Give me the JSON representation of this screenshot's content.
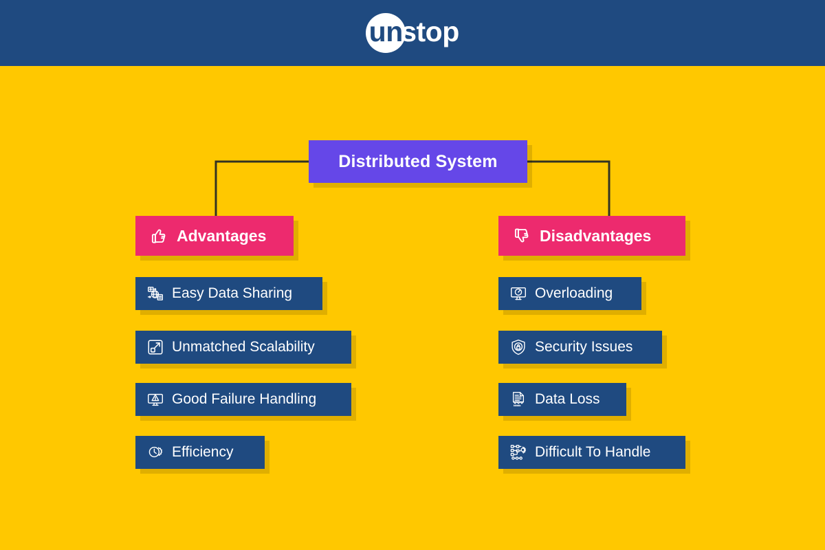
{
  "header": {
    "brand": {
      "mark_text": "un",
      "word_text": "stop",
      "full_name": "unstop"
    },
    "background_color": "#1F4A80"
  },
  "canvas": {
    "background_color": "#FFC800",
    "connector_color": "#333322"
  },
  "diagram": {
    "type": "tree",
    "root": {
      "label": "Distributed System",
      "color": "#6547E8"
    },
    "branches": [
      {
        "id": "advantages",
        "label": "Advantages",
        "icon": "thumbs-up-icon",
        "color": "#ED2A6E",
        "children": [
          {
            "label": "Easy Data Sharing",
            "icon": "data-sharing-icon",
            "color": "#1F4A80"
          },
          {
            "label": "Unmatched Scalability",
            "icon": "scalability-icon",
            "color": "#1F4A80"
          },
          {
            "label": "Good Failure Handling",
            "icon": "monitor-warning-icon",
            "color": "#1F4A80"
          },
          {
            "label": "Efficiency",
            "icon": "clock-gear-icon",
            "color": "#1F4A80"
          }
        ]
      },
      {
        "id": "disadvantages",
        "label": "Disadvantages",
        "icon": "thumbs-down-icon",
        "color": "#ED2A6E",
        "children": [
          {
            "label": "Overloading",
            "icon": "monitor-gauge-icon",
            "color": "#1F4A80"
          },
          {
            "label": "Security Issues",
            "icon": "shield-lock-icon",
            "color": "#1F4A80"
          },
          {
            "label": "Data Loss",
            "icon": "document-binary-icon",
            "color": "#1F4A80"
          },
          {
            "label": "Difficult To Handle",
            "icon": "network-gear-icon",
            "color": "#1F4A80"
          }
        ]
      }
    ]
  }
}
